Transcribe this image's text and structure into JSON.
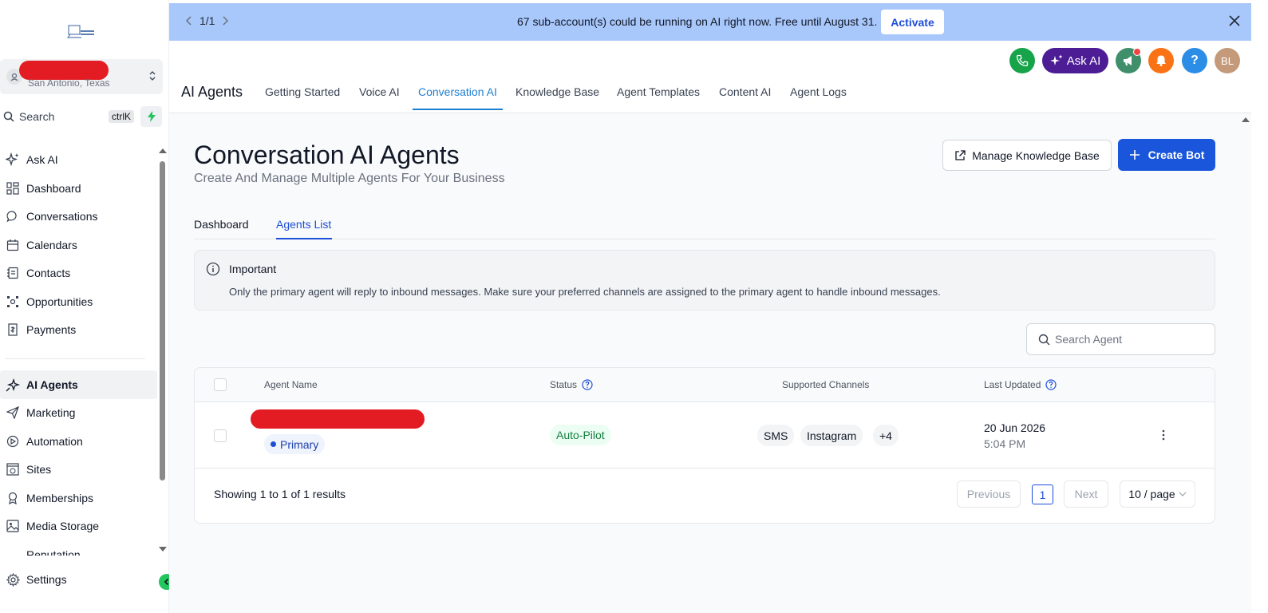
{
  "colors": {
    "accent": "#1d7ed2",
    "primary_button": "#1a56db",
    "banner": "#a8c7fa",
    "status_green": "#15803d",
    "ask_ai_purple": "#4c1d95"
  },
  "sidebar": {
    "location_city": "San Antonio, Texas",
    "search_label": "Search",
    "search_shortcut": "ctrlK",
    "items": [
      {
        "label": "Ask AI",
        "icon": "sparkle-icon"
      },
      {
        "label": "Dashboard",
        "icon": "grid-icon"
      },
      {
        "label": "Conversations",
        "icon": "chat-bubble-icon"
      },
      {
        "label": "Calendars",
        "icon": "calendar-icon"
      },
      {
        "label": "Contacts",
        "icon": "contact-card-icon"
      },
      {
        "label": "Opportunities",
        "icon": "opportunities-icon"
      },
      {
        "label": "Payments",
        "icon": "receipt-icon"
      },
      {
        "label": "AI Agents",
        "icon": "ai-agents-icon"
      },
      {
        "label": "Marketing",
        "icon": "paper-plane-icon"
      },
      {
        "label": "Automation",
        "icon": "automation-icon"
      },
      {
        "label": "Sites",
        "icon": "globe-window-icon"
      },
      {
        "label": "Memberships",
        "icon": "award-icon"
      },
      {
        "label": "Media Storage",
        "icon": "image-icon"
      }
    ],
    "cut_item": "Reputation",
    "settings_label": "Settings"
  },
  "banner": {
    "pager": "1/1",
    "message": "67 sub-account(s) could be running on AI right now. Free until August 31.",
    "activate_label": "Activate"
  },
  "topbar": {
    "ask_ai_label": "Ask AI",
    "help_label": "?",
    "avatar_initials": "BL"
  },
  "header": {
    "title": "AI Agents",
    "tabs": [
      "Getting Started",
      "Voice AI",
      "Conversation AI",
      "Knowledge Base",
      "Agent Templates",
      "Content AI",
      "Agent Logs"
    ],
    "active_tab": "Conversation AI"
  },
  "main": {
    "title": "Conversation AI Agents",
    "subtitle": "Create And Manage Multiple Agents For Your Business",
    "manage_kb_label": "Manage Knowledge Base",
    "create_bot_label": "Create Bot",
    "subtabs": [
      "Dashboard",
      "Agents List"
    ],
    "active_subtab": "Agents List",
    "alert_title": "Important",
    "alert_text": "Only the primary agent will reply to inbound messages. Make sure your preferred channels are assigned to the primary agent to handle inbound messages.",
    "search_placeholder": "Search Agent"
  },
  "table": {
    "columns": [
      "Agent Name",
      "Status",
      "Supported Channels",
      "Last Updated"
    ],
    "rows": [
      {
        "badge": "Primary",
        "status": "Auto-Pilot",
        "channels": [
          "SMS",
          "Instagram",
          "+4"
        ],
        "date": "20 Jun 2026",
        "time": "5:04 PM"
      }
    ],
    "showing_text": "Showing 1 to 1 of 1 results",
    "prev_label": "Previous",
    "page": "1",
    "next_label": "Next",
    "page_size": "10 / page"
  }
}
